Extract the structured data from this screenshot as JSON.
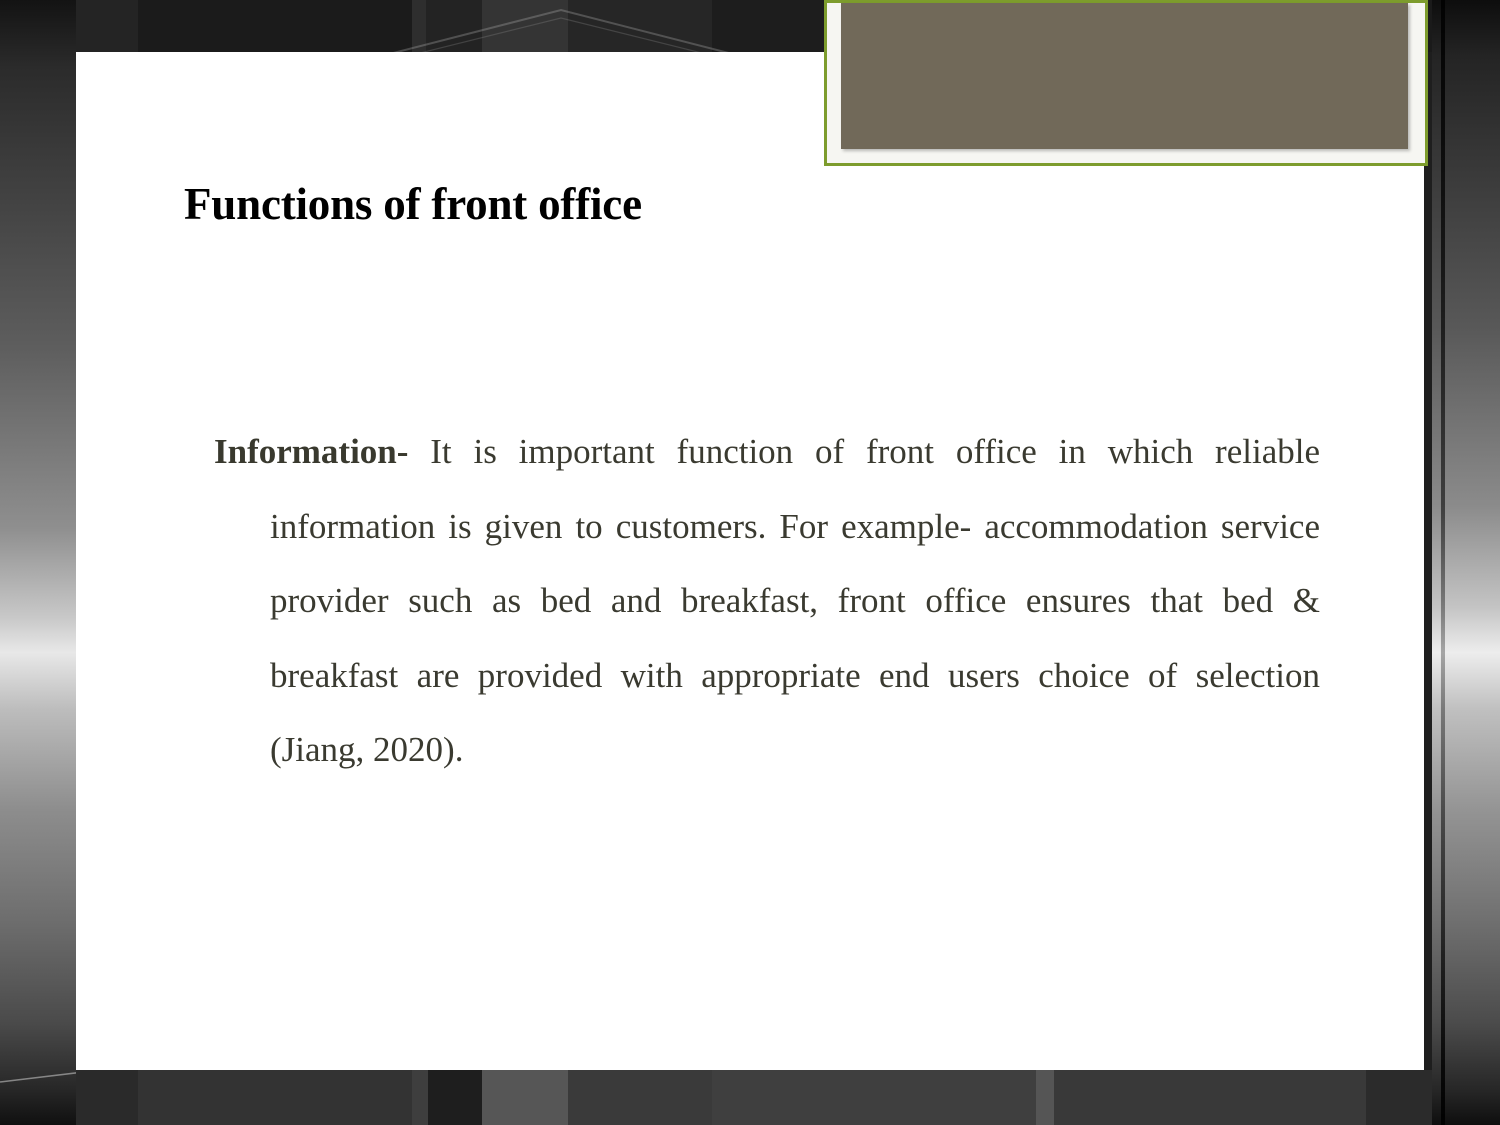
{
  "slide": {
    "title": "Functions of front office",
    "body": {
      "lead_label": "Information-",
      "text": " It is important function of front office in which reliable information is given to customers. For example- accommodation service provider such as bed and breakfast, front office ensures that bed & breakfast are provided with appropriate end users choice of selection (Jiang, 2020)."
    },
    "decoration": {
      "picture_placeholder_label": "",
      "frame_border_color": "#7d9c2d",
      "frame_inner_color": "#716959",
      "frame_mat_color": "#f6f6f2"
    },
    "colors": {
      "slide_background": "#ffffff",
      "title_text": "#000000",
      "body_text": "#3a3a30",
      "accent_green": "#7d9c2d",
      "backdrop_dark": "#1e1e1e"
    }
  }
}
